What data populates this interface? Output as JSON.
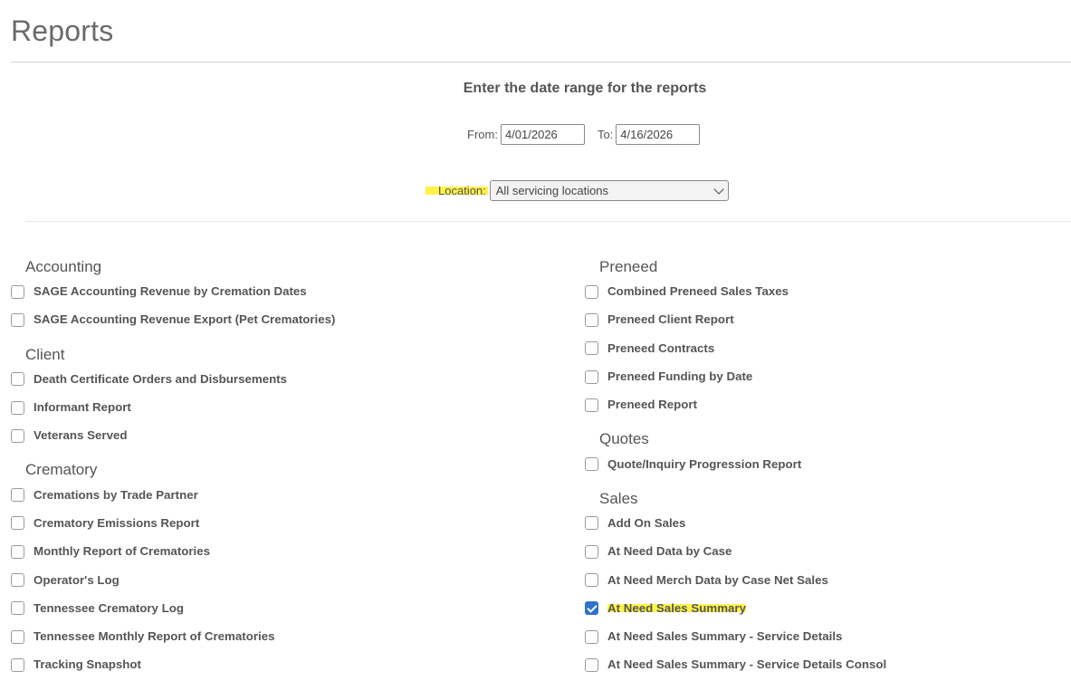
{
  "page": {
    "title": "Reports"
  },
  "date_range": {
    "heading": "Enter the date range for the reports",
    "from_label": "From:",
    "from_value": "4/01/2026",
    "to_label": "To:",
    "to_value": "4/16/2026"
  },
  "location": {
    "label": "Location:",
    "selected": "All servicing locations"
  },
  "accent_color": "#2f73c9",
  "highlight_color": "#fff34a",
  "left_groups": [
    {
      "title": "Accounting",
      "items": [
        {
          "label": "SAGE Accounting Revenue by Cremation Dates",
          "checked": false
        },
        {
          "label": "SAGE Accounting Revenue Export (Pet Crematories)",
          "checked": false
        }
      ]
    },
    {
      "title": "Client",
      "items": [
        {
          "label": "Death Certificate Orders and Disbursements",
          "checked": false
        },
        {
          "label": "Informant Report",
          "checked": false
        },
        {
          "label": "Veterans Served",
          "checked": false
        }
      ]
    },
    {
      "title": "Crematory",
      "items": [
        {
          "label": "Cremations by Trade Partner",
          "checked": false
        },
        {
          "label": "Crematory Emissions Report",
          "checked": false
        },
        {
          "label": "Monthly Report of Crematories",
          "checked": false
        },
        {
          "label": "Operator's Log",
          "checked": false
        },
        {
          "label": "Tennessee Crematory Log",
          "checked": false
        },
        {
          "label": "Tennessee Monthly Report of Crematories",
          "checked": false
        },
        {
          "label": "Tracking Snapshot",
          "checked": false
        }
      ]
    }
  ],
  "right_groups": [
    {
      "title": "Preneed",
      "items": [
        {
          "label": "Combined Preneed Sales Taxes",
          "checked": false
        },
        {
          "label": "Preneed Client Report",
          "checked": false
        },
        {
          "label": "Preneed Contracts",
          "checked": false
        },
        {
          "label": "Preneed Funding by Date",
          "checked": false
        },
        {
          "label": "Preneed Report",
          "checked": false
        }
      ]
    },
    {
      "title": "Quotes",
      "items": [
        {
          "label": "Quote/Inquiry Progression Report",
          "checked": false
        }
      ]
    },
    {
      "title": "Sales",
      "items": [
        {
          "label": "Add On Sales",
          "checked": false
        },
        {
          "label": "At Need Data by Case",
          "checked": false
        },
        {
          "label": "At Need Merch Data by Case Net Sales",
          "checked": false
        },
        {
          "label": "At Need Sales Summary",
          "checked": true,
          "highlighted": true
        },
        {
          "label": "At Need Sales Summary - Service Details",
          "checked": false
        },
        {
          "label": "At Need Sales Summary - Service Details Consol",
          "checked": false
        }
      ]
    }
  ]
}
